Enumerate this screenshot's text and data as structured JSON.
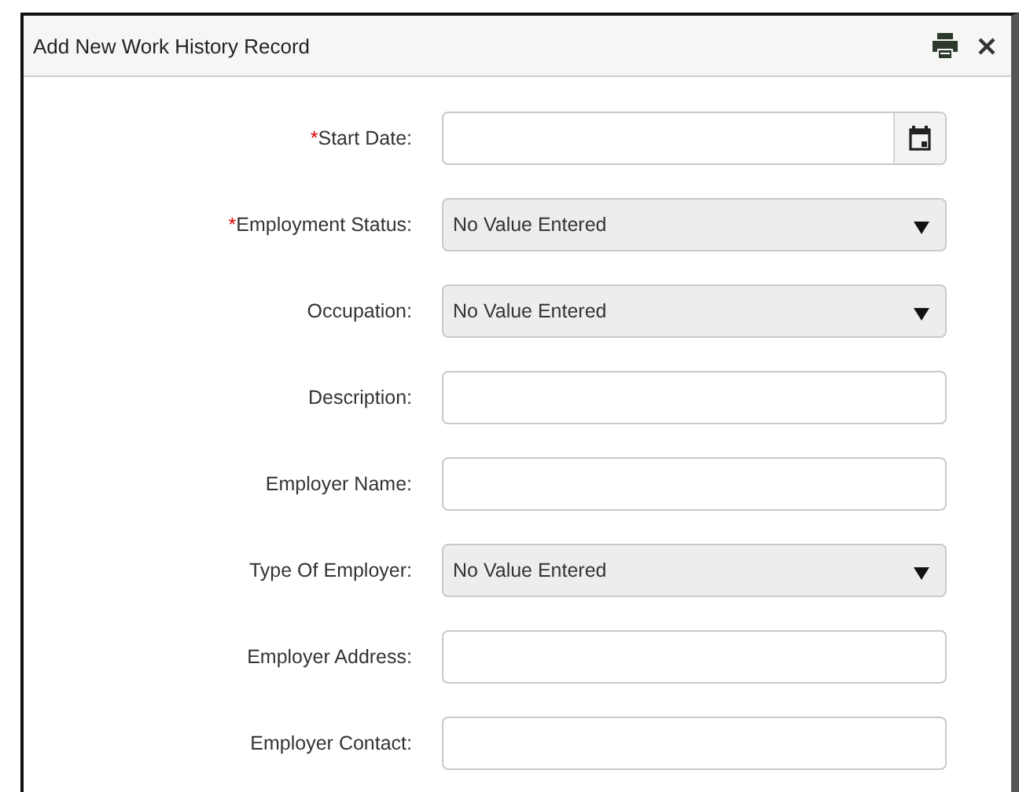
{
  "dialog": {
    "title": "Add New Work History Record"
  },
  "required_mark": "*",
  "fields": [
    {
      "label": "Start Date:",
      "kind": "date",
      "required": true
    },
    {
      "label": "Employment Status:",
      "kind": "select",
      "required": true,
      "value": "No Value Entered"
    },
    {
      "label": "Occupation:",
      "kind": "select",
      "required": false,
      "value": "No Value Entered"
    },
    {
      "label": "Description:",
      "kind": "text",
      "required": false
    },
    {
      "label": "Employer Name:",
      "kind": "text",
      "required": false
    },
    {
      "label": "Type Of Employer:",
      "kind": "select",
      "required": false,
      "value": "No Value Entered"
    },
    {
      "label": "Employer Address:",
      "kind": "text",
      "required": false
    },
    {
      "label": "Employer Contact:",
      "kind": "text",
      "required": false
    }
  ]
}
